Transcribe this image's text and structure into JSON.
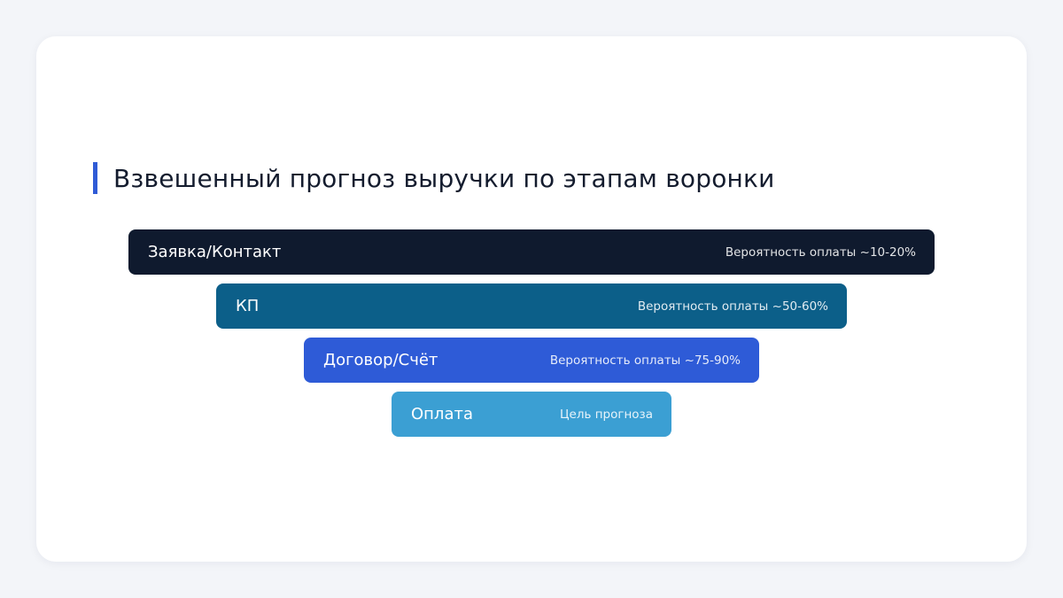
{
  "title": "Взвешенный прогноз выручки по этапам воронки",
  "colors": {
    "accent": "#2f5bd6",
    "stage_colors": [
      "#0f1a2e",
      "#0c5f89",
      "#2e5bd7",
      "#3b9fd3"
    ]
  },
  "stages": [
    {
      "label": "Заявка/Контакт",
      "note": "Вероятность оплаты ~10-20%"
    },
    {
      "label": "КП",
      "note": "Вероятность оплаты ~50-60%"
    },
    {
      "label": "Договор/Счёт",
      "note": "Вероятность оплаты ~75-90%"
    },
    {
      "label": "Оплата",
      "note": "Цель прогноза"
    }
  ]
}
